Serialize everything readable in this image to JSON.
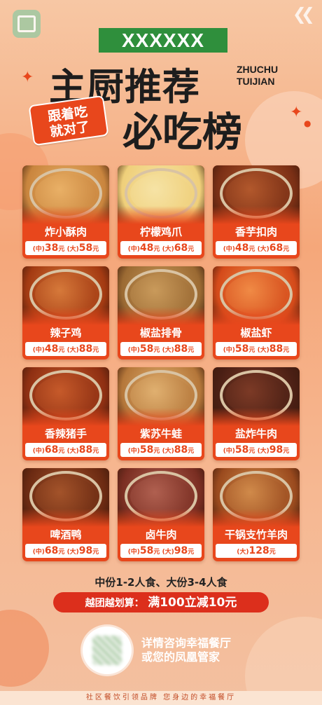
{
  "header": {
    "banner": "XXXXXX",
    "title_line1": "主厨推荐",
    "title_line2": "必吃榜",
    "pinyin_line1": "ZHUCHU",
    "pinyin_line2": "TUIJIAN",
    "stamp_line1": "跟着吃",
    "stamp_line2": "就对了"
  },
  "dishes": [
    {
      "name": "炸小酥肉",
      "prices": [
        {
          "size": "(中)",
          "value": "38",
          "unit": "元"
        },
        {
          "size": "(大)",
          "value": "58",
          "unit": "元"
        }
      ],
      "colors": [
        "#c9853e",
        "#e9b066"
      ]
    },
    {
      "name": "柠檬鸡爪",
      "prices": [
        {
          "size": "(中)",
          "value": "48",
          "unit": "元"
        },
        {
          "size": "(大)",
          "value": "68",
          "unit": "元"
        }
      ],
      "colors": [
        "#efcf7a",
        "#f6e3a5"
      ]
    },
    {
      "name": "香芋扣肉",
      "prices": [
        {
          "size": "(中)",
          "value": "48",
          "unit": "元"
        },
        {
          "size": "(大)",
          "value": "68",
          "unit": "元"
        }
      ],
      "colors": [
        "#7a2f15",
        "#b2582c"
      ]
    },
    {
      "name": "辣子鸡",
      "prices": [
        {
          "size": "(中)",
          "value": "48",
          "unit": "元"
        },
        {
          "size": "(大)",
          "value": "88",
          "unit": "元"
        }
      ],
      "colors": [
        "#a33a12",
        "#d6793a"
      ]
    },
    {
      "name": "椒盐排骨",
      "prices": [
        {
          "size": "(中)",
          "value": "58",
          "unit": "元"
        },
        {
          "size": "(大)",
          "value": "88",
          "unit": "元"
        }
      ],
      "colors": [
        "#9b6a33",
        "#c99a5b"
      ]
    },
    {
      "name": "椒盐虾",
      "prices": [
        {
          "size": "(中)",
          "value": "58",
          "unit": "元"
        },
        {
          "size": "(大)",
          "value": "88",
          "unit": "元"
        }
      ],
      "colors": [
        "#d44a1a",
        "#f08a45"
      ]
    },
    {
      "name": "香辣猪手",
      "prices": [
        {
          "size": "(中)",
          "value": "68",
          "unit": "元"
        },
        {
          "size": "(大)",
          "value": "88",
          "unit": "元"
        }
      ],
      "colors": [
        "#8e2f12",
        "#c65a2a"
      ]
    },
    {
      "name": "紫苏牛蛙",
      "prices": [
        {
          "size": "(中)",
          "value": "58",
          "unit": "元"
        },
        {
          "size": "(大)",
          "value": "88",
          "unit": "元"
        }
      ],
      "colors": [
        "#b5773a",
        "#e0b070"
      ]
    },
    {
      "name": "盐炸牛肉",
      "prices": [
        {
          "size": "(中)",
          "value": "58",
          "unit": "元"
        },
        {
          "size": "(大)",
          "value": "98",
          "unit": "元"
        }
      ],
      "colors": [
        "#4a1f14",
        "#7c3a26"
      ]
    },
    {
      "name": "啤酒鸭",
      "prices": [
        {
          "size": "(中)",
          "value": "68",
          "unit": "元"
        },
        {
          "size": "(大)",
          "value": "98",
          "unit": "元"
        }
      ],
      "colors": [
        "#6b2a12",
        "#a3532a"
      ]
    },
    {
      "name": "卤牛肉",
      "prices": [
        {
          "size": "(中)",
          "value": "58",
          "unit": "元"
        },
        {
          "size": "(大)",
          "value": "98",
          "unit": "元"
        }
      ],
      "colors": [
        "#7a2e22",
        "#b06050"
      ]
    },
    {
      "name": "干锅支竹羊肉",
      "prices": [
        {
          "size": "(大)",
          "value": "128",
          "unit": "元"
        }
      ],
      "colors": [
        "#9a4a1e",
        "#d08a4a"
      ]
    }
  ],
  "portion_note": "中份1-2人食、大份3-4人食",
  "promo": {
    "label": "越团越划算：",
    "offer": "满100立减10元"
  },
  "contact": {
    "line1": "详情咨询幸福餐厅",
    "line2": "或您的凤凰管家"
  },
  "footer": "社区餐饮引领品牌  您身边的幸福餐厅",
  "colors": {
    "accent": "#e8471c",
    "banner_green": "#2f8f3c",
    "promo_red": "#dc2f1c"
  },
  "icons": [
    "logo-icon",
    "chevron-icon",
    "sparkle-icon",
    "qr-code"
  ]
}
